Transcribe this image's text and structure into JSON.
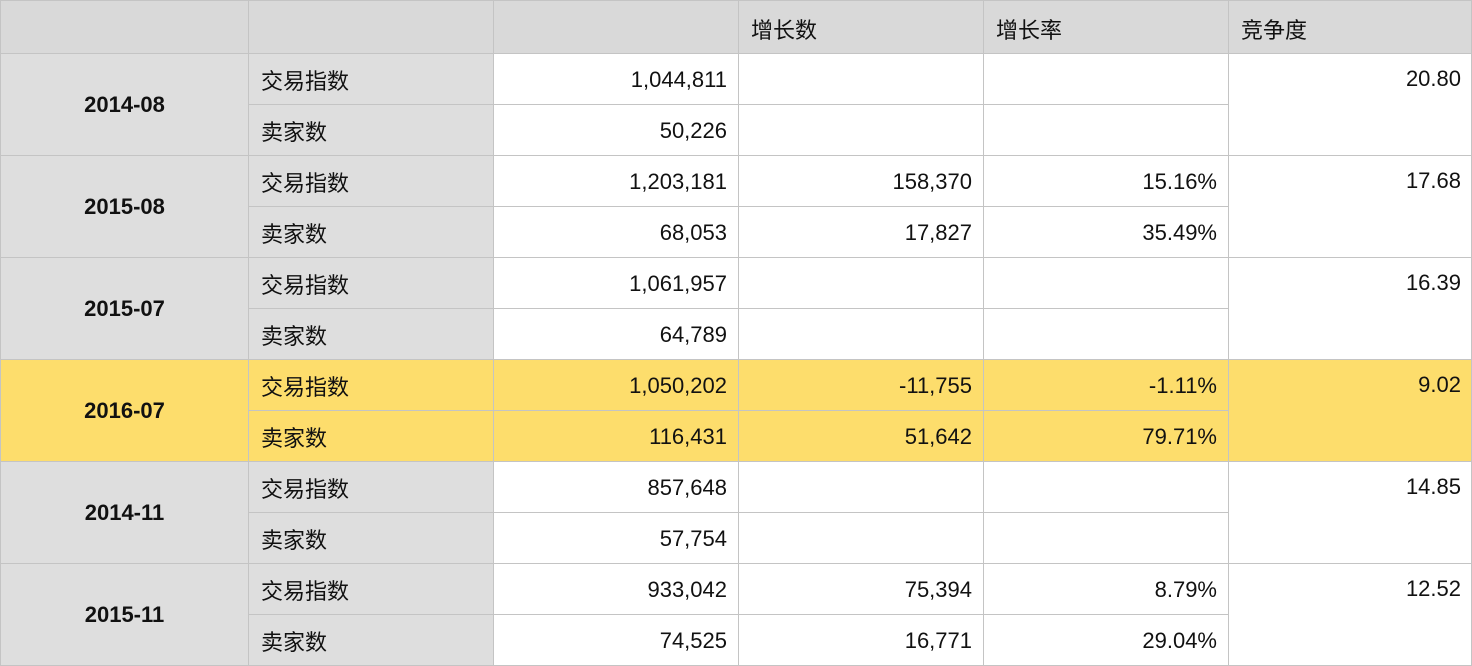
{
  "header": {
    "col_a": "",
    "col_b": "",
    "col_c": "",
    "col_d": "增长数",
    "col_e": "增长率",
    "col_f": "竞争度"
  },
  "groups": [
    {
      "period": "2014-08",
      "highlighted": false,
      "competition": "20.80",
      "rows": [
        {
          "metric": "交易指数",
          "value": "1,044,811",
          "growth": "",
          "rate": ""
        },
        {
          "metric": "卖家数",
          "value": "50,226",
          "growth": "",
          "rate": ""
        }
      ]
    },
    {
      "period": "2015-08",
      "highlighted": false,
      "competition": "17.68",
      "rows": [
        {
          "metric": "交易指数",
          "value": "1,203,181",
          "growth": "158,370",
          "rate": "15.16%"
        },
        {
          "metric": "卖家数",
          "value": "68,053",
          "growth": "17,827",
          "rate": "35.49%"
        }
      ]
    },
    {
      "period": "2015-07",
      "highlighted": false,
      "competition": "16.39",
      "rows": [
        {
          "metric": "交易指数",
          "value": "1,061,957",
          "growth": "",
          "rate": ""
        },
        {
          "metric": "卖家数",
          "value": "64,789",
          "growth": "",
          "rate": ""
        }
      ]
    },
    {
      "period": "2016-07",
      "highlighted": true,
      "competition": "9.02",
      "rows": [
        {
          "metric": "交易指数",
          "value": "1,050,202",
          "growth": "-11,755",
          "rate": "-1.11%"
        },
        {
          "metric": "卖家数",
          "value": "116,431",
          "growth": "51,642",
          "rate": "79.71%"
        }
      ]
    },
    {
      "period": "2014-11",
      "highlighted": false,
      "competition": "14.85",
      "rows": [
        {
          "metric": "交易指数",
          "value": "857,648",
          "growth": "",
          "rate": ""
        },
        {
          "metric": "卖家数",
          "value": "57,754",
          "growth": "",
          "rate": ""
        }
      ]
    },
    {
      "period": "2015-11",
      "highlighted": false,
      "competition": "12.52",
      "rows": [
        {
          "metric": "交易指数",
          "value": "933,042",
          "growth": "75,394",
          "rate": "8.79%"
        },
        {
          "metric": "卖家数",
          "value": "74,525",
          "growth": "16,771",
          "rate": "29.04%"
        }
      ]
    }
  ],
  "colors": {
    "header_bg": "#d9d9d9",
    "label_bg": "#dedede",
    "highlight_bg": "#fddd6c",
    "grid": "#c4c4c4"
  }
}
